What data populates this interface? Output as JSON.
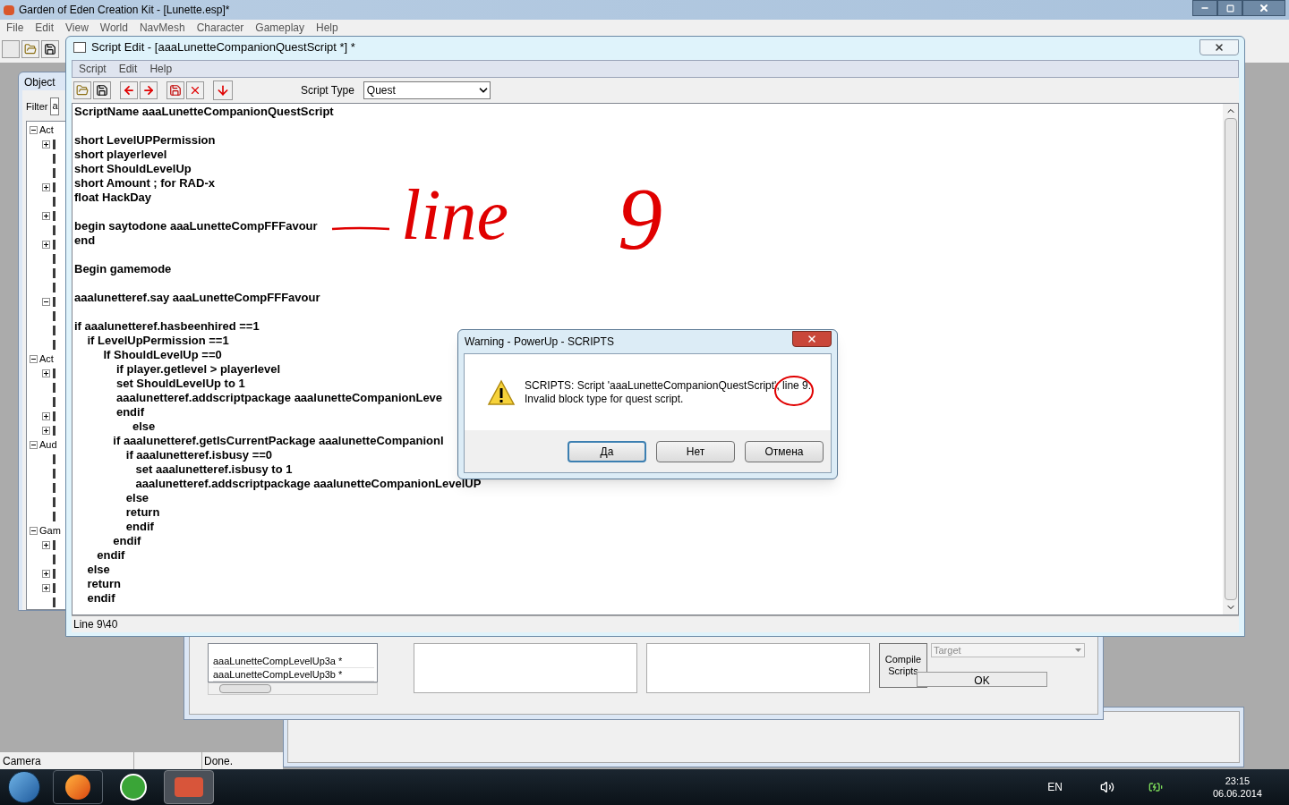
{
  "app": {
    "title": "Garden of Eden Creation Kit - [Lunette.esp]*",
    "menu": [
      "File",
      "Edit",
      "View",
      "World",
      "NavMesh",
      "Character",
      "Gameplay",
      "Help"
    ]
  },
  "object_window": {
    "title": "Object",
    "filter_label": "Filter",
    "filter_value": "a",
    "tree": [
      {
        "label": "Act",
        "expanded": true,
        "children": [
          {
            "kind": "plus"
          },
          {
            "kind": "leaf"
          },
          {
            "kind": "leaf"
          },
          {
            "kind": "plus"
          },
          {
            "kind": "leaf"
          },
          {
            "kind": "plus"
          },
          {
            "kind": "leaf"
          },
          {
            "kind": "plus"
          },
          {
            "kind": "leaf"
          },
          {
            "kind": "leaf"
          },
          {
            "kind": "leaf"
          },
          {
            "kind": "minus"
          },
          {
            "kind": "leaf"
          },
          {
            "kind": "leaf"
          },
          {
            "kind": "leaf"
          }
        ]
      },
      {
        "label": "Act",
        "expanded": true,
        "children": [
          {
            "kind": "plus"
          },
          {
            "kind": "leaf"
          },
          {
            "kind": "leaf"
          },
          {
            "kind": "plus"
          },
          {
            "kind": "plus"
          }
        ]
      },
      {
        "label": "Aud",
        "expanded": true,
        "children": [
          {
            "kind": "leaf"
          },
          {
            "kind": "leaf"
          },
          {
            "kind": "leaf"
          },
          {
            "kind": "leaf"
          },
          {
            "kind": "leaf"
          }
        ]
      },
      {
        "label": "Gam",
        "expanded": true,
        "children": [
          {
            "kind": "plus"
          },
          {
            "kind": "leaf"
          },
          {
            "kind": "plus"
          },
          {
            "kind": "plus"
          },
          {
            "kind": "leaf"
          }
        ]
      }
    ]
  },
  "editor": {
    "title": "Script Edit - [aaaLunetteCompanionQuestScript *] *",
    "menu": [
      "Script",
      "Edit",
      "Help"
    ],
    "script_type_label": "Script Type",
    "script_type": "Quest",
    "code_blocks": [
      [
        "ScriptName aaaLunetteCompanionQuestScript"
      ],
      [
        "short LevelUPPermission",
        "short playerlevel",
        "short ShouldLevelUp",
        "short Amount ; for RAD-x",
        "float HackDay"
      ],
      [
        "begin saytodone aaaLunetteCompFFFavour",
        "end"
      ],
      [
        "Begin gamemode"
      ],
      [
        "aaalunetteref.say aaaLunetteCompFFFavour"
      ],
      [
        "if aaalunetteref.hasbeenhired ==1",
        "    if LevelUpPermission ==1",
        "         If ShouldLevelUp ==0",
        "             if player.getlevel > playerlevel",
        "             set ShouldLevelUp to 1",
        "             aaalunetteref.addscriptpackage aaalunetteCompanionLeve",
        "             endif",
        "                  else",
        "            if aaalunetteref.getIsCurrentPackage aaalunetteCompanionl",
        "                if aaalunetteref.isbusy ==0",
        "                   set aaalunetteref.isbusy to 1",
        "                   aaalunetteref.addscriptpackage aaalunetteCompanionLevelUP",
        "                else",
        "                return",
        "                endif",
        "            endif",
        "       endif",
        "    else",
        "    return",
        "    endif"
      ]
    ],
    "status": "Line 9\\40"
  },
  "annotation": {
    "word": "line",
    "digit": "9"
  },
  "dialog": {
    "title": "Warning - PowerUp - SCRIPTS",
    "message": [
      "SCRIPTS: Script 'aaaLunetteCompanionQuestScript', line 9:",
      "Invalid block type for quest script."
    ],
    "buttons": [
      {
        "label": "Да",
        "default": true
      },
      {
        "label": "Нет",
        "default": false
      },
      {
        "label": "Отмена",
        "default": false
      }
    ]
  },
  "script_panel": {
    "list": [
      "aaaLunetteCompLevelUp3a *",
      "aaaLunetteCompLevelUp3b *"
    ],
    "compile_button": "Compile Scripts",
    "target_placeholder": "Target",
    "ok_button": "OK"
  },
  "status_bar": [
    "Camera",
    "Done."
  ],
  "taskbar": {
    "language": "EN",
    "time": "23:15",
    "date": "06.06.2014"
  }
}
